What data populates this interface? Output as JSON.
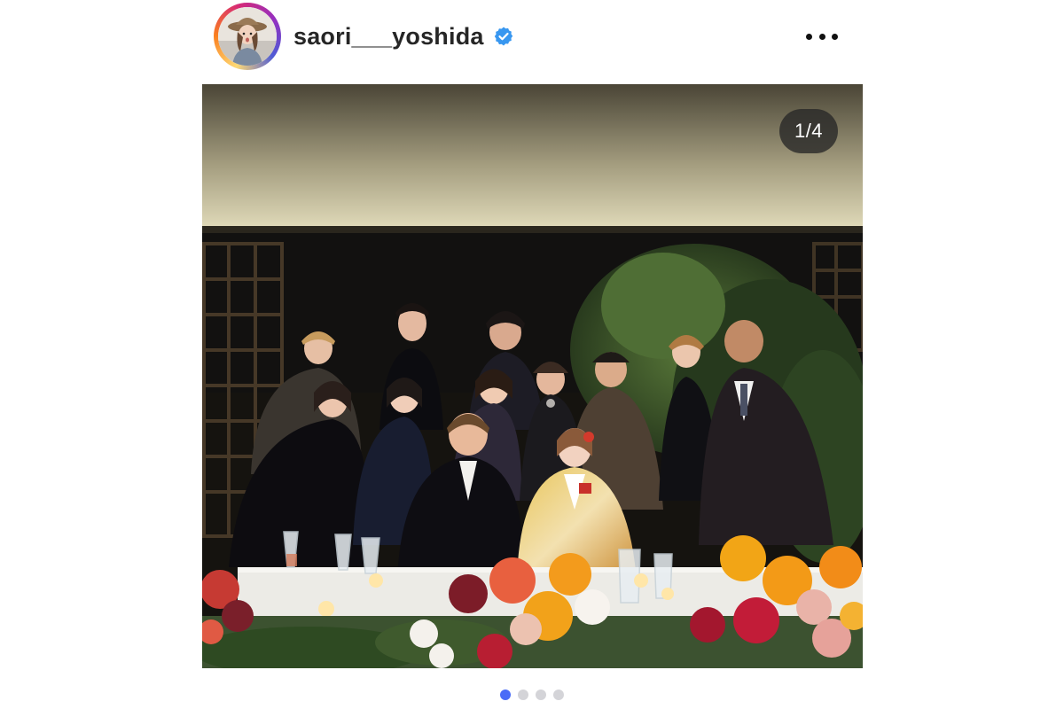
{
  "post": {
    "username": "saori___yoshida",
    "verified": true,
    "more_label": "More options",
    "carousel": {
      "current": 1,
      "total": 4,
      "counter_text": "1/4"
    }
  },
  "colors": {
    "verified_blue": "#3897f0",
    "active_dot": "#4a6cf7",
    "inactive_dot": "#d4d4d8"
  },
  "icons": [
    "avatar-photo",
    "verified-badge-icon",
    "more-options-icon"
  ]
}
